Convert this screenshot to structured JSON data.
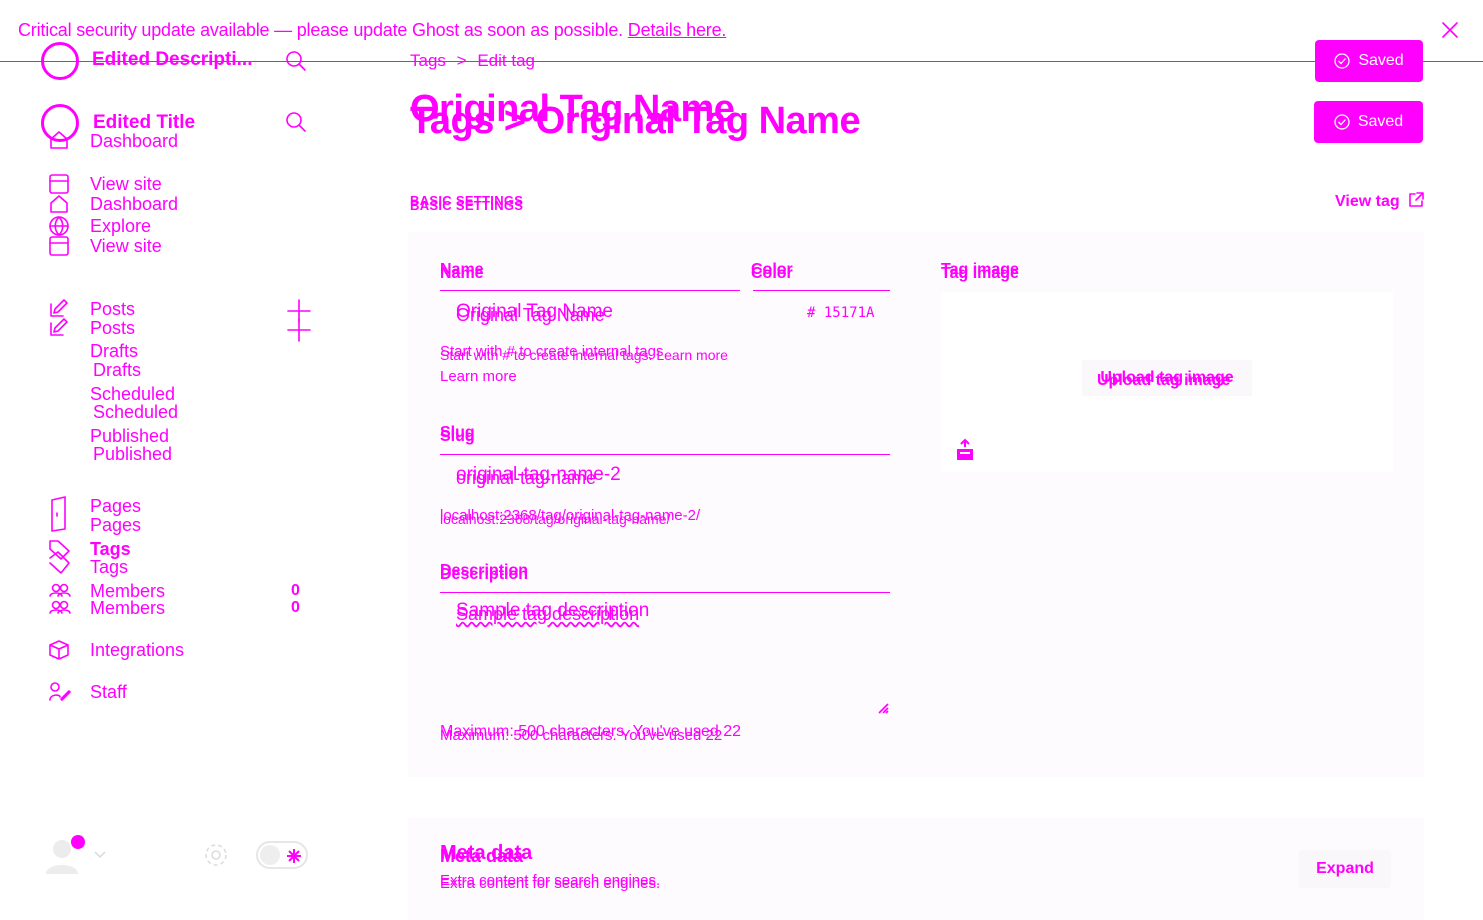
{
  "colors": {
    "accent": "#ff00ff",
    "background": "#ffffff"
  },
  "banner": {
    "text": "Critical security update available — please update Ghost as soon as possible.",
    "link": "Details here."
  },
  "sidebar": {
    "site_title_1": "Edited Descripti...",
    "site_title_2": "Edited Title",
    "nav_a": [
      {
        "label": "Dashboard",
        "icon": "home-icon"
      },
      {
        "label": "View site",
        "icon": "browser-icon"
      },
      {
        "label": "Dashboard",
        "icon": "home-icon"
      },
      {
        "label": "Explore",
        "icon": "globe-icon"
      },
      {
        "label": "View site",
        "icon": "browser-icon"
      }
    ],
    "posts": [
      "Posts",
      "Posts"
    ],
    "sub_items": [
      "Drafts",
      "Drafts",
      "Scheduled",
      "Scheduled",
      "Published",
      "Published"
    ],
    "pages": [
      "Pages",
      "Pages"
    ],
    "tags": [
      "Tags",
      "Tags"
    ],
    "members": [
      "Members",
      "Members"
    ],
    "members_counts": [
      "0",
      "0"
    ],
    "integrations": "Integrations",
    "staff": "Staff"
  },
  "header": {
    "crumb_tags": "Tags",
    "crumb_sep": ">",
    "crumb_edit": "Edit tag",
    "title_1": "Original Tag Name",
    "title_2": "Tags > Original Tag Name",
    "saved_label": "Saved"
  },
  "settings": {
    "section_title": "BASIC SETTINGS",
    "view_tag": "View tag",
    "name_label": "Name",
    "name_value": "Original Tag Name",
    "color_label": "Color",
    "color_value": "# 15171A",
    "name_hint": "Start with # to create internal tags.",
    "learn_more": "Learn more",
    "name_hint_2": "Start with # to create internal tags. Learn more",
    "slug_label": "Slug",
    "slug_value_1": "original-tag-name-2",
    "slug_value_2": "original-tag-name",
    "url_1": "localhost:2368/tag/original-tag-name-2/",
    "url_2": "localhost:2368/tag/original-tag-name/",
    "description_label": "Description",
    "description_value": "Sample tag description",
    "description_hint": "Maximum: 500 characters. You've used 22",
    "tag_image_label": "Tag image",
    "upload_label": "Upload tag image"
  },
  "meta": {
    "title": "Meta data",
    "subtitle": "Extra content for search engines.",
    "expand": "Expand"
  }
}
